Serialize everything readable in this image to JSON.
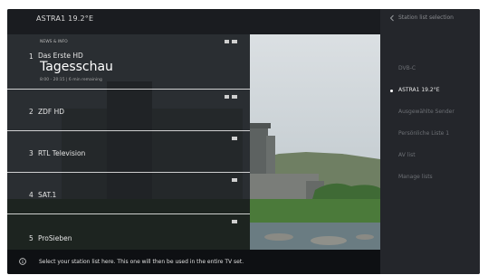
{
  "header": {
    "satellite": "ASTRA1 19.2°E"
  },
  "stations": [
    {
      "number": "1",
      "name": "Das Erste HD",
      "genre": "NEWS & INFO",
      "program": "Tagesschau",
      "time": "8:00 - 20:15 | 6 min remaining",
      "active": true
    },
    {
      "number": "2",
      "name": "ZDF HD"
    },
    {
      "number": "3",
      "name": "RTL Television"
    },
    {
      "number": "4",
      "name": "SAT.1"
    },
    {
      "number": "5",
      "name": "ProSieben"
    }
  ],
  "info_bar": {
    "text": "Select your station list here. This one will then be used in the entire TV set."
  },
  "menu": {
    "title": "Station list selection",
    "items": [
      {
        "label": "DVB-C",
        "active": false
      },
      {
        "label": "ASTRA1 19.2°E",
        "active": true
      },
      {
        "label": "Ausgewählte Sender",
        "active": false
      },
      {
        "label": "Persönliche Liste 1",
        "active": false
      },
      {
        "label": "AV list",
        "active": false
      },
      {
        "label": "Manage lists",
        "active": false
      }
    ]
  },
  "colors": {
    "menu_bg": "#24262b",
    "list_bg": "#14161a",
    "active_text": "#e8e8e8",
    "inactive_text": "#6d7075"
  },
  "icons": [
    "info-icon",
    "back-icon",
    "bullet-icon",
    "channel-feature-icon"
  ]
}
